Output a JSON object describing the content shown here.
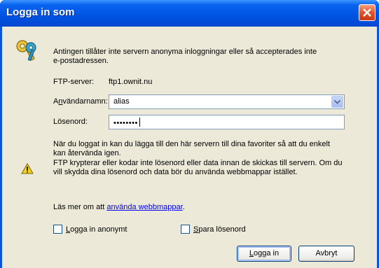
{
  "window": {
    "title": "Logga in som"
  },
  "message": {
    "line1": "Antingen tillåter inte servern anonyma inloggningar eller så accepterades inte",
    "line2": "e-postadressen."
  },
  "ftp": {
    "label": "FTP-server:",
    "value": "ftp1.ownit.nu"
  },
  "username": {
    "label_pre": "A",
    "label_accel": "n",
    "label_post": "vändarnamn:",
    "value": "alias"
  },
  "password": {
    "label": "Lösenord:",
    "value": "••••••••"
  },
  "info": {
    "line1": "När du loggat in kan du lägga till den här servern till dina favoriter så att du enkelt",
    "line2": "kan återvända igen.",
    "line3": "FTP krypterar eller kodar inte lösenord eller data innan de skickas till servern. Om du",
    "line4": "vill skydda dina lösenord och data bör du använda webbmappar istället."
  },
  "learn_more": {
    "prefix": "Läs mer om att ",
    "link": "använda webbmappar",
    "suffix": "."
  },
  "anon": {
    "accel": "L",
    "rest": "ogga in anonymt",
    "checked": false
  },
  "save": {
    "accel": "S",
    "rest": "para lösenord",
    "checked": false
  },
  "buttons": {
    "login_accel": "L",
    "login_rest": "ogga in",
    "cancel": "Avbryt"
  },
  "colors": {
    "titlebar": "#0055e5",
    "client": "#ece9d8",
    "link": "#0000ee"
  },
  "icons": [
    "close-icon",
    "key-icon",
    "warning-icon",
    "chevron-down-icon"
  ]
}
